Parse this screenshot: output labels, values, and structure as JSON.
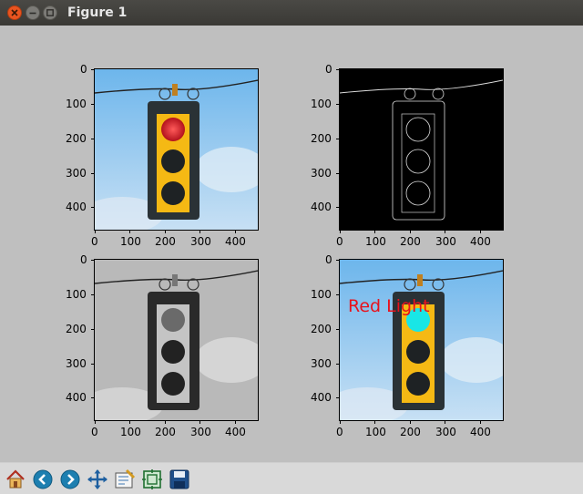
{
  "window": {
    "title": "Figure 1"
  },
  "figure": {
    "subplots": [
      {
        "name": "original",
        "x_ticks": [
          "0",
          "100",
          "200",
          "300",
          "400"
        ],
        "y_ticks": [
          "0",
          "100",
          "200",
          "300",
          "400"
        ]
      },
      {
        "name": "edges",
        "x_ticks": [
          "0",
          "100",
          "200",
          "300",
          "400"
        ],
        "y_ticks": [
          "0",
          "100",
          "200",
          "300",
          "400"
        ]
      },
      {
        "name": "grayscale",
        "x_ticks": [
          "0",
          "100",
          "200",
          "300",
          "400"
        ],
        "y_ticks": [
          "0",
          "100",
          "200",
          "300",
          "400"
        ]
      },
      {
        "name": "detected",
        "x_ticks": [
          "0",
          "100",
          "200",
          "300",
          "400"
        ],
        "y_ticks": [
          "0",
          "100",
          "200",
          "300",
          "400"
        ],
        "annotation": "Red Light",
        "annotation_color": "#e8121c",
        "marker_color": "#19e6e6"
      }
    ]
  },
  "toolbar": {
    "buttons": [
      "home-icon",
      "back-icon",
      "forward-icon",
      "pan-icon",
      "zoom-icon",
      "subplots-icon",
      "save-icon"
    ]
  },
  "colors": {
    "figure_bg": "#bfbfbf",
    "sky": "#86c3ee",
    "housing": "#f5b914",
    "red_lamp": "#d0202a",
    "edge_bg": "#000000"
  }
}
